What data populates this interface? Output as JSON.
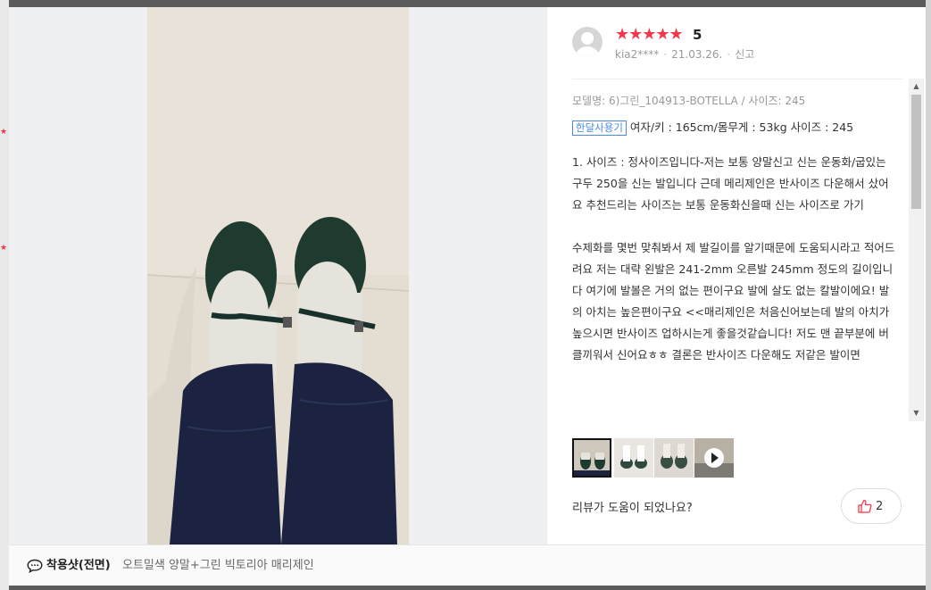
{
  "review": {
    "rating_stars": "★★★★★",
    "score": "5",
    "user": "kia2****",
    "date": "21.03.26.",
    "report": "신고",
    "model": "모델명: 6)그린_104913-BOTELLA / 사이즈: 245",
    "usage_tag": "한달사용기",
    "body_info": "여자/키 : 165cm/몸무게 : 53kg 사이즈 : 245",
    "paragraphs": [
      "1. 사이즈 : 정사이즈입니다-저는 보통 양말신고 신는 운동화/굽있는 구두 250을 신는 발입니다 근데 메리제인은 반사이즈 다운해서 샀어요 추천드리는 사이즈는 보통 운동화신을때 신는 사이즈로 가기",
      "수제화를 몇번 맞춰봐서 제 발길이를 알기때문에 도움되시라고 적어드려요 저는 대략 왼발은 241-2mm 오른발 245mm 정도의 길이입니다 여기에 발볼은 거의 없는 편이구요 발에 살도 없는 칼발이에요! 발의 아치는 높은편이구요 <<매리제인은 처음신어보는데 발의 아치가 높으시면 반사이즈 업하시는게 좋을것같습니다! 저도 맨 끝부분에 버클끼워서 신어요ㅎㅎ 결론은 반사이즈 다운해도 저같은 발이면"
    ],
    "helpful_question": "리뷰가 도움이 되었나요?",
    "like_count": "2"
  },
  "footer": {
    "label": "착용샷(전면)",
    "description": "오트밀색 양말+그린 빅토리아 매리제인"
  },
  "colors": {
    "star": "#f4384c",
    "tag": "#4a8ad9",
    "shoe": "#1f3a2e",
    "pants": "#1b2340"
  },
  "icons": {
    "avatar": "user-avatar-icon",
    "like": "thumbs-up-icon",
    "footer": "speech-bubble-icon",
    "video": "play-icon"
  }
}
